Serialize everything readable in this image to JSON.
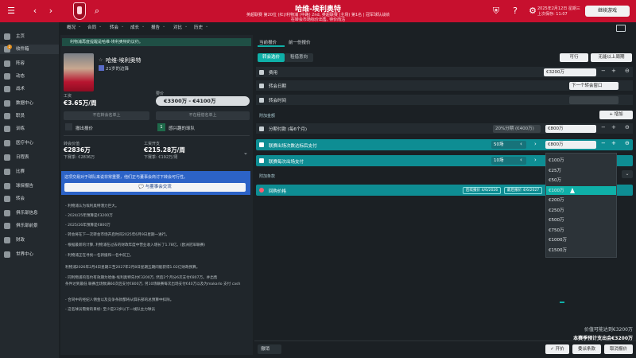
{
  "topbar": {
    "title": "哈维-埃利奥特",
    "subtitle_1": "英超联赛 第20位 (红)/利物浦 (中路) 2nd, 英超联赛 (主场) 第1名 | 冠军球队战绩",
    "subtitle_2": "在转会市场标价出售, 待价而沽",
    "date": "2025年2月12日 星期三",
    "save_status": "上次保存: 11:07",
    "continue_label": "继续游戏",
    "back_icon": "chevron-left-icon",
    "forward_icon": "chevron-right-icon",
    "search_icon": "search-icon",
    "home_icon": "home-icon",
    "accent": "#c7102e"
  },
  "sidebar": {
    "items": [
      {
        "label": "主页",
        "icon": "home-icon"
      },
      {
        "label": "收件箱",
        "icon": "inbox-icon",
        "badge": "2"
      },
      {
        "label": "阵容",
        "icon": "squad-icon"
      },
      {
        "label": "动态",
        "icon": "news-icon"
      },
      {
        "label": "战术",
        "icon": "tactics-icon"
      },
      {
        "label": "数据中心",
        "icon": "data-icon"
      },
      {
        "label": "职员",
        "icon": "staff-icon"
      },
      {
        "label": "训练",
        "icon": "training-icon"
      },
      {
        "label": "医疗中心",
        "icon": "medical-icon"
      },
      {
        "label": "日程表",
        "icon": "calendar-icon"
      },
      {
        "label": "比赛",
        "icon": "match-icon"
      },
      {
        "label": "球探报告",
        "icon": "scouting-icon"
      },
      {
        "label": "转会",
        "icon": "transfer-icon"
      },
      {
        "label": "俱乐部信息",
        "icon": "club-icon"
      },
      {
        "label": "俱乐部前景",
        "icon": "vision-icon"
      },
      {
        "label": "财政",
        "icon": "finance-icon"
      },
      {
        "label": "世界中心",
        "icon": "world-icon"
      }
    ]
  },
  "nav": [
    "概况",
    "合同",
    "转会",
    "成长",
    "报告",
    "对比",
    "历史"
  ],
  "player": {
    "info_bar": "利物浦再度提醒是哈维-埃利奥特的议约。",
    "name": "哈维-埃利奥特",
    "position": "21岁的边锋",
    "wage_label": "工资",
    "wage_value": "€3.65万/周",
    "asking_wage_label": "要价",
    "asking_wage_value": "€3300万 - €4100万",
    "btn_unavailable": "不在转会名单上",
    "btn_not_loan": "不在租借名单上",
    "btn_withdraw": "撤出报价",
    "btn_interested": "感兴趣的球队",
    "interested_count": "1",
    "transfer_value_label": "转会价值",
    "transfer_value": "€2836万",
    "transfer_sub": "下赛季: €2836万",
    "asking_label": "工资开支",
    "asking_value": "€215.28万/周",
    "asking_sub": "下赛季: €192万/周",
    "blue_message": "这项交易对于球队来说非常重要，他们正与董事会商讨下转会可行性。",
    "blue_button": "与董事会交流",
    "notes": [
      "- 利物浦认为埃利奥特潜力巨大。",
      "- 2024/25年预算是€3200万",
      "- 2025/26年预算是€800万",
      "- 转会将在下一次转会市场开启时间2025年6月9日星期一进行。",
      "- 根据最新的计算, 利物浦在过去的财政年度中营业收入增长了1.78亿。(欧洲冠军联赛)",
      "- 利物浦正在寻找一名新援和一名中前卫。",
      "利物浦2026年2月4日星期三至2027年2月8日星期五期间能获得1.02亿财政预算。",
      "- 同利物浦的签约有效期为哈维-埃利奥特先付€3200万, 然后2个月分6次支付€807万。并出售",
      "  条件达到最低 联赛出场数满60次后支付€800万, 另10场联赛每次出场支付€40万以及为makarlo 支付 cash",
      "- 合同中的经纪人佣金以及竞争条款都将从俱乐部的总预算中扣除。",
      "- 这名球员需要的目标: 至少是23岁以下一线队主力球员"
    ]
  },
  "offer": {
    "tabs": [
      "当前报价",
      "前一份报价"
    ],
    "subtabs": [
      "转会选价",
      "租借意向"
    ],
    "btn_feasible": "可行",
    "btn_ask": "无能以上周期",
    "rows": [
      {
        "label": "费用",
        "value": "€3200万"
      },
      {
        "label": "转会日期",
        "value": "下一个转会窗口"
      },
      {
        "label": "转会时间",
        "value": ""
      }
    ],
    "additional_label": "附加金额",
    "add_button": "增加",
    "installments_label": "分期付款 (每6个月)",
    "installments_period": "20%分期 (€400万)",
    "installments_value": "€800万",
    "bonus1_label": "联赛出场次数达标后支付",
    "bonus1_count": "50场",
    "bonus1_value": "€800万",
    "bonus2_label": "联赛每次出场支付",
    "bonus2_count": "10场",
    "additional_terms_label": "附加条款",
    "buyback_label": "回购价格",
    "buyback_pill1": "后续报价 4/6/2026",
    "buyback_pill2": "最后报价 4/6/2027",
    "dropdown_options": [
      "€100万",
      "€25万",
      "€50万",
      "€100万",
      "€200万",
      "€250万",
      "€500万",
      "€750万",
      "€1000万",
      "€1500万"
    ],
    "dropdown_selected_index": 3,
    "summary_1": "价值可能达到€3200万",
    "summary_2": "本赛季预计支出会€3200万",
    "btn_cancel": "撤销",
    "btn_offer": "开价",
    "btn_delegate": "委派条款",
    "btn_cancel_offer": "取消报价",
    "accent": "#0fb0a8"
  }
}
